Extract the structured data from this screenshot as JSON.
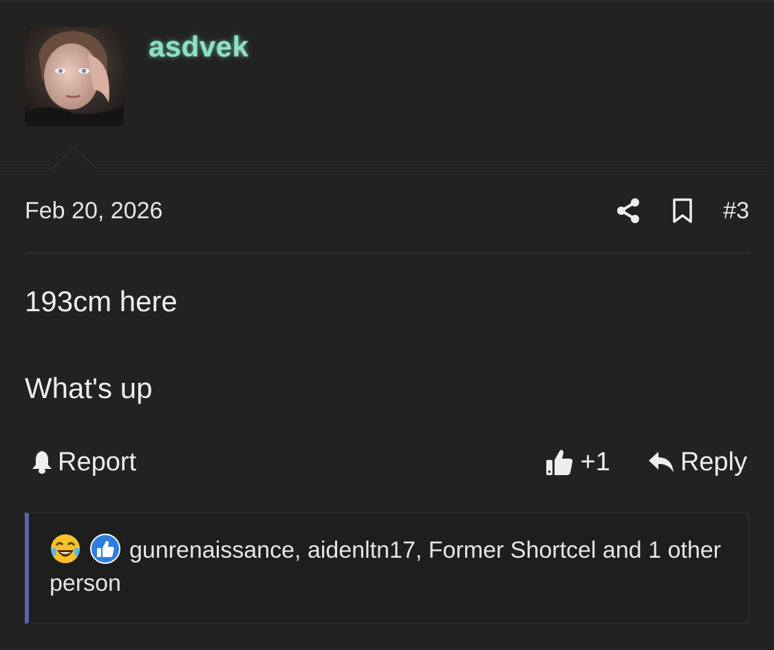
{
  "post": {
    "username": "asdvek",
    "date": "Feb 20, 2026",
    "post_number": "#3",
    "body": [
      "193cm here",
      "What's up"
    ],
    "actions": {
      "report_label": "Report",
      "like_label": "+1",
      "reply_label": "Reply"
    },
    "reactions": {
      "text": "gunrenaissance, aidenltn17, Former Shortcel and 1 other person",
      "icons": [
        "laughing-crying-emoji",
        "thumbs-up-reaction"
      ]
    }
  },
  "colors": {
    "username": "#8fe0c6",
    "background": "#222222",
    "reaction_border": "#5b63b3"
  }
}
